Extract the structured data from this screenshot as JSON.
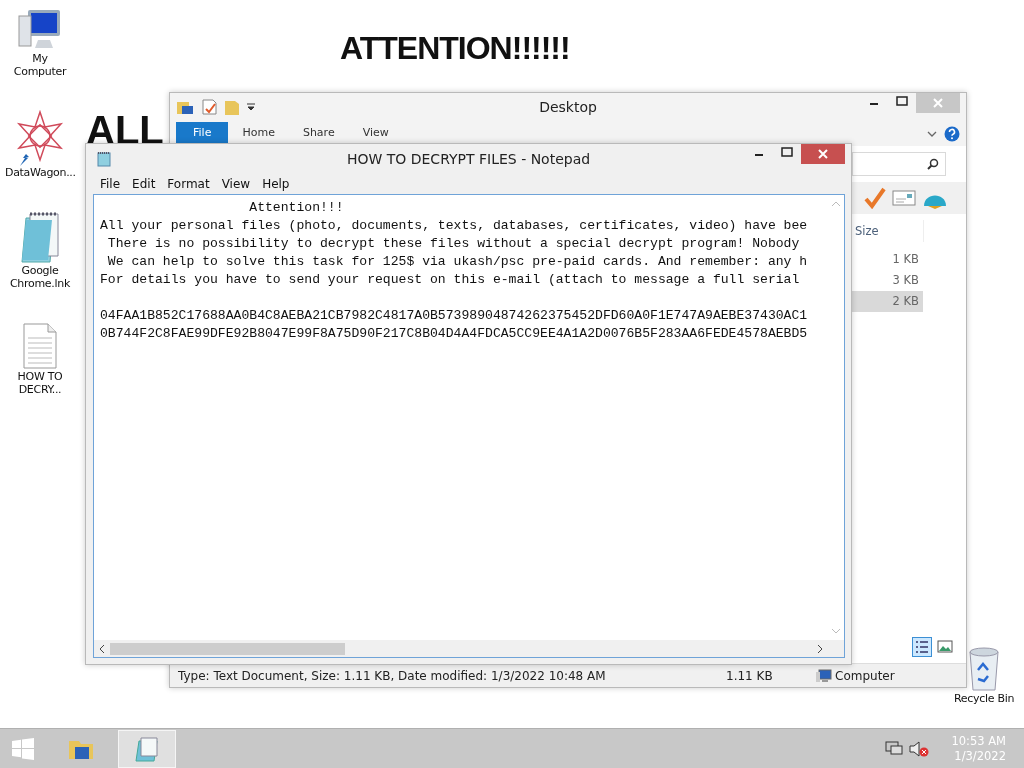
{
  "desktop": {
    "banner": "ATTENTION!!!!!!",
    "banner_partial": "ALL",
    "icons": [
      {
        "label": "My Computer",
        "kind": "computer"
      },
      {
        "label": "DataWagon...",
        "kind": "star"
      },
      {
        "label": "Google Chrome.lnk",
        "kind": "notepad"
      },
      {
        "label": "HOW TO DECRY...",
        "kind": "document"
      },
      {
        "label": "Recycle Bin",
        "kind": "bin"
      }
    ]
  },
  "explorer": {
    "title": "Desktop",
    "ribbon_tabs": [
      {
        "label": "File",
        "selected": true
      },
      {
        "label": "Home",
        "selected": false
      },
      {
        "label": "Share",
        "selected": false
      },
      {
        "label": "View",
        "selected": false
      }
    ],
    "columns": [
      "Size"
    ],
    "rows": [
      {
        "size": "1 KB",
        "selected": false
      },
      {
        "size": "3 KB",
        "selected": false
      },
      {
        "size": "2 KB",
        "selected": true
      }
    ],
    "status_bar": {
      "info": "Type: Text Document, Size: 1.11 KB, Date modified: 1/3/2022 10:48 AM",
      "size": "1.11 KB",
      "zone": "Computer"
    }
  },
  "notepad": {
    "title": "HOW TO DECRYPT FILES - Notepad",
    "menu": [
      "File",
      "Edit",
      "Format",
      "View",
      "Help"
    ],
    "lines": [
      "                   Attention!!!",
      "All your personal files (photo, documents, texts, databases, certificates, video) have bee",
      " There is no possibility to decrypt these files without a special decrypt program! Nobody",
      " We can help to solve this task for 125$ via ukash/psc pre-paid cards. And remember: any h",
      "For details you have to send your request on this e-mail (attach to message a full serial"
    ],
    "key_lines": [
      "04FAA1B852C17688AA0B4C8AEBA21CB7982C4817A0B57398904874262375452DFD60A0F1E747A9AEBE37430AC1",
      "0B744F2C8FAE99DFE92B8047E99F8A75D90F217C8B04D4A4FDCA5CC9EE4A1A2D0076B5F283AA6FEDE4578AEBD5"
    ]
  },
  "taskbar": {
    "apps": [
      {
        "kind": "explorer",
        "active": false
      },
      {
        "kind": "notepad",
        "active": true
      }
    ],
    "time": "10:53 AM",
    "date": "1/3/2022"
  }
}
